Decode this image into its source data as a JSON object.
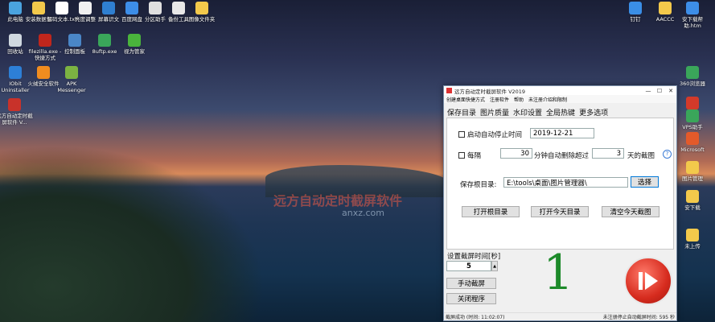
{
  "desktop": {
    "top_icons": [
      {
        "label": "此电脑",
        "icon": "this-pc-icon",
        "color": "#4aa3df"
      },
      {
        "label": "安装数据包",
        "icon": "folder-icon",
        "color": "#f3c94b"
      },
      {
        "label": "解码文本.txt",
        "icon": "text-file-icon",
        "color": "#ffffff"
      },
      {
        "label": "亮度调整",
        "icon": "file-icon",
        "color": "#f0f0f0"
      },
      {
        "label": "屏幕识文",
        "icon": "ocr-icon",
        "color": "#2f7fd1"
      },
      {
        "label": "百度网盘",
        "icon": "cloud-icon",
        "color": "#3d8ee8"
      },
      {
        "label": "分区助手",
        "icon": "disk-icon",
        "color": "#e0e0e0"
      },
      {
        "label": "备份工具",
        "icon": "backup-icon",
        "color": "#e8e8e8"
      },
      {
        "label": "图像文件夹",
        "icon": "folder-icon",
        "color": "#f3c94b"
      }
    ],
    "row2_icons": [
      {
        "label": "回收站",
        "icon": "recycle-bin-icon",
        "color": "#cfd8e0"
      },
      {
        "label": "filezilla.exe - 快捷方式",
        "icon": "filezilla-icon",
        "color": "#c0261c"
      },
      {
        "label": "控制面板",
        "icon": "control-panel-icon",
        "color": "#4a86c7"
      },
      {
        "label": "8uftp.exe",
        "icon": "ftp-icon",
        "color": "#3aa65a"
      },
      {
        "label": "视为管家",
        "icon": "wechat-icon",
        "color": "#4ab43c"
      }
    ],
    "row3_icons": [
      {
        "label": "IObit Uninstaller",
        "icon": "uninstaller-icon",
        "color": "#2d7fd6"
      },
      {
        "label": "火绒安全软件",
        "icon": "shield-icon",
        "color": "#f08c1f"
      },
      {
        "label": "APK Messenger",
        "icon": "apk-icon",
        "color": "#7cb342"
      }
    ],
    "row4_icons": [
      {
        "label": "远方自动定时截屏软件 V...",
        "icon": "screenshot-app-icon",
        "color": "#c8322a"
      }
    ],
    "right_icons": [
      {
        "label": "钉钉",
        "icon": "dingtalk-icon",
        "color": "#3a8ee6"
      },
      {
        "label": "AACCC",
        "icon": "folder-icon",
        "color": "#f3c94b"
      },
      {
        "label": "安下载帮助.htm",
        "icon": "html-icon",
        "color": "#3d8ee8"
      },
      {
        "label": "360浏览器",
        "icon": "browser-icon",
        "color": "#3aa65a"
      },
      {
        "label": "",
        "icon": "app-icon",
        "color": "#d33a2a"
      },
      {
        "label": "VPS助手",
        "icon": "vps-icon",
        "color": "#3aa65a"
      },
      {
        "label": "Microsoft",
        "icon": "edge-icon",
        "color": "#e45a2a"
      },
      {
        "label": "图片管理",
        "icon": "folder-icon",
        "color": "#f3c94b"
      },
      {
        "label": "安下载",
        "icon": "folder-icon",
        "color": "#f3c94b"
      },
      {
        "label": "未上传",
        "icon": "folder-icon",
        "color": "#f3c94b"
      }
    ],
    "watermark_line1": "远方自动定时截屏软件",
    "watermark_line2": "anxz.com"
  },
  "window": {
    "title": "远方自动定时截屏软件 V2019",
    "controls": [
      "—",
      "☐",
      "✕"
    ],
    "menu": [
      "创建桌面快捷方式",
      "注册软件",
      "帮助",
      "未注册介绍和限制"
    ],
    "tabs": [
      "保存目录",
      "图片质量",
      "水印设置",
      "全局热键",
      "更多选项"
    ],
    "auto_stop_label": "启动自动停止时间",
    "auto_stop_date": "2019-12-21",
    "every_label": "每隔",
    "every_value": "30",
    "delete_mid_label": "分钟自动删除超过",
    "days_value": "3",
    "days_suffix": "天的截图",
    "help_symbol": "?",
    "save_root_label": "保存根目录:",
    "save_root_path": "E:\\tools\\桌面\\图片管理器\\",
    "choose_button": "选择",
    "open_root_button": "打开根目录",
    "open_today_button": "打开今天目录",
    "clear_today_button": "清空今天截图",
    "interval_label": "设置截屏时间[秒]",
    "interval_value": "5",
    "manual_button": "手动截屏",
    "close_button": "关闭程序",
    "counter": "1",
    "status_left": "截屏成功 (时间: 11:02:07)",
    "status_right": "未注册停止自动截屏时间: 595 秒",
    "colors": {
      "accent": "#0078d7",
      "record": "#d62b1e",
      "counter": "#1d8a2a"
    }
  }
}
